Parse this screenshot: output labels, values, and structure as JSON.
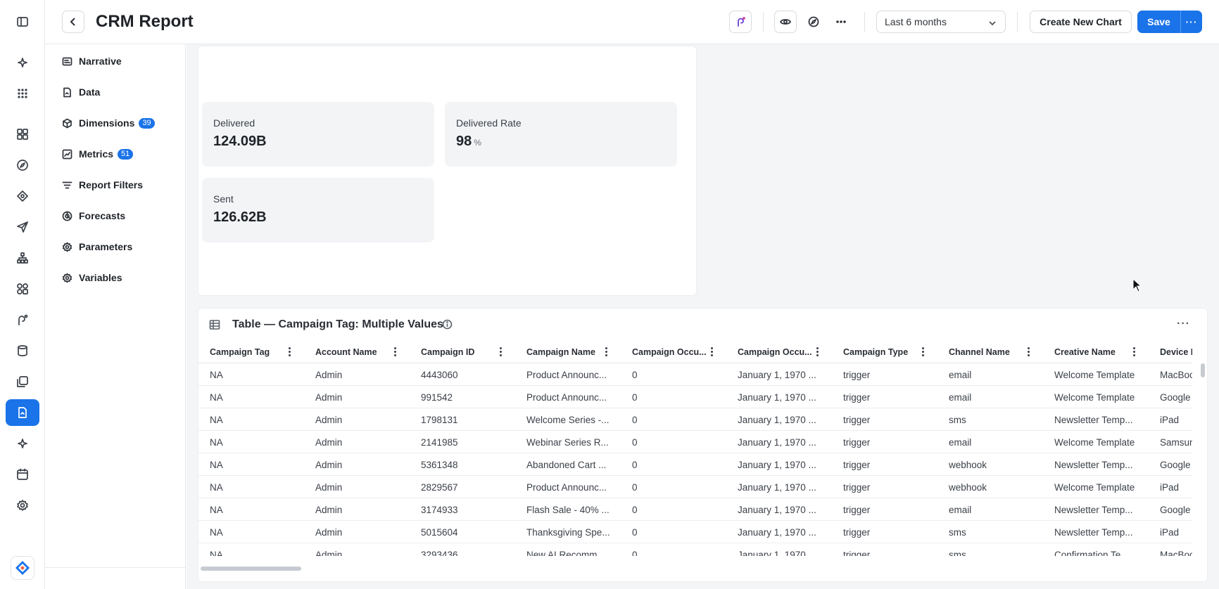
{
  "header": {
    "title": "CRM Report",
    "date_range": "Last 6 months",
    "create_chart_label": "Create New Chart",
    "save_label": "Save",
    "save_more_label": "···"
  },
  "sidebar": {
    "items": [
      {
        "label": "Narrative",
        "icon": "narrative-icon"
      },
      {
        "label": "Data",
        "icon": "data-icon"
      },
      {
        "label": "Dimensions",
        "icon": "cube-icon",
        "badge": "39"
      },
      {
        "label": "Metrics",
        "icon": "metrics-icon",
        "badge": "51"
      },
      {
        "label": "Report Filters",
        "icon": "filter-icon"
      },
      {
        "label": "Forecasts",
        "icon": "forecast-icon"
      },
      {
        "label": "Parameters",
        "icon": "gear-icon"
      },
      {
        "label": "Variables",
        "icon": "gear-icon"
      }
    ]
  },
  "kpis": [
    {
      "label": "Delivered",
      "value": "124.09B",
      "unit": ""
    },
    {
      "label": "Delivered Rate",
      "value": "98",
      "unit": "%"
    },
    {
      "label": "Sent",
      "value": "126.62B",
      "unit": ""
    }
  ],
  "table": {
    "title": "Table — Campaign Tag: Multiple Values",
    "columns": [
      "Campaign Tag",
      "Account Name",
      "Campaign ID",
      "Campaign Name",
      "Campaign Occu...",
      "Campaign Occu...",
      "Campaign Type",
      "Channel Name",
      "Creative Name",
      "Device Name"
    ],
    "rows": [
      [
        "NA",
        "Admin",
        "4443060",
        "Product Announc...",
        "0",
        "January 1, 1970 ...",
        "trigger",
        "email",
        "Welcome Template",
        "MacBook"
      ],
      [
        "NA",
        "Admin",
        "991542",
        "Product Announc...",
        "0",
        "January 1, 1970 ...",
        "trigger",
        "email",
        "Welcome Template",
        "Google P"
      ],
      [
        "NA",
        "Admin",
        "1798131",
        "Welcome Series -...",
        "0",
        "January 1, 1970 ...",
        "trigger",
        "sms",
        "Newsletter Temp...",
        "iPad"
      ],
      [
        "NA",
        "Admin",
        "2141985",
        "Webinar Series R...",
        "0",
        "January 1, 1970 ...",
        "trigger",
        "email",
        "Welcome Template",
        "Samsung"
      ],
      [
        "NA",
        "Admin",
        "5361348",
        "Abandoned Cart ...",
        "0",
        "January 1, 1970 ...",
        "trigger",
        "webhook",
        "Newsletter Temp...",
        "Google P"
      ],
      [
        "NA",
        "Admin",
        "2829567",
        "Product Announc...",
        "0",
        "January 1, 1970 ...",
        "trigger",
        "webhook",
        "Welcome Template",
        "iPad"
      ],
      [
        "NA",
        "Admin",
        "3174933",
        "Flash Sale - 40% ...",
        "0",
        "January 1, 1970 ...",
        "trigger",
        "email",
        "Newsletter Temp...",
        "Google P"
      ],
      [
        "NA",
        "Admin",
        "5015604",
        "Thanksgiving Spe...",
        "0",
        "January 1, 1970 ...",
        "trigger",
        "sms",
        "Newsletter Temp...",
        "iPad"
      ],
      [
        "NA",
        "Admin",
        "3293436",
        "New AI Recomm...",
        "0",
        "January 1, 1970 ...",
        "trigger",
        "sms",
        "Confirmation Te...",
        "MacBook"
      ]
    ]
  },
  "colors": {
    "accent": "#1a73e8",
    "canvas": "#f4f5f7",
    "card": "#f3f4f6"
  }
}
